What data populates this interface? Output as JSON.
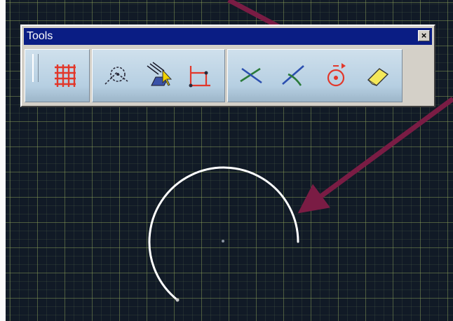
{
  "toolbar": {
    "title": "Tools",
    "close_label": "×",
    "groups": [
      {
        "tools": [
          {
            "icon": "grid-icon"
          }
        ]
      },
      {
        "tools": [
          {
            "icon": "construction-profile-icon"
          },
          {
            "icon": "snap-select-icon"
          },
          {
            "icon": "dimension-constraint-icon"
          }
        ]
      },
      {
        "tools": [
          {
            "icon": "trim-icon"
          },
          {
            "icon": "break-icon"
          },
          {
            "icon": "arc-trim-icon"
          },
          {
            "icon": "eraser-icon"
          }
        ]
      }
    ]
  },
  "canvas": {
    "background_color": "#111a26",
    "grid_color": "#96aa5a",
    "arc_color": "#ffffff",
    "arrow_color": "#7a1c44"
  }
}
